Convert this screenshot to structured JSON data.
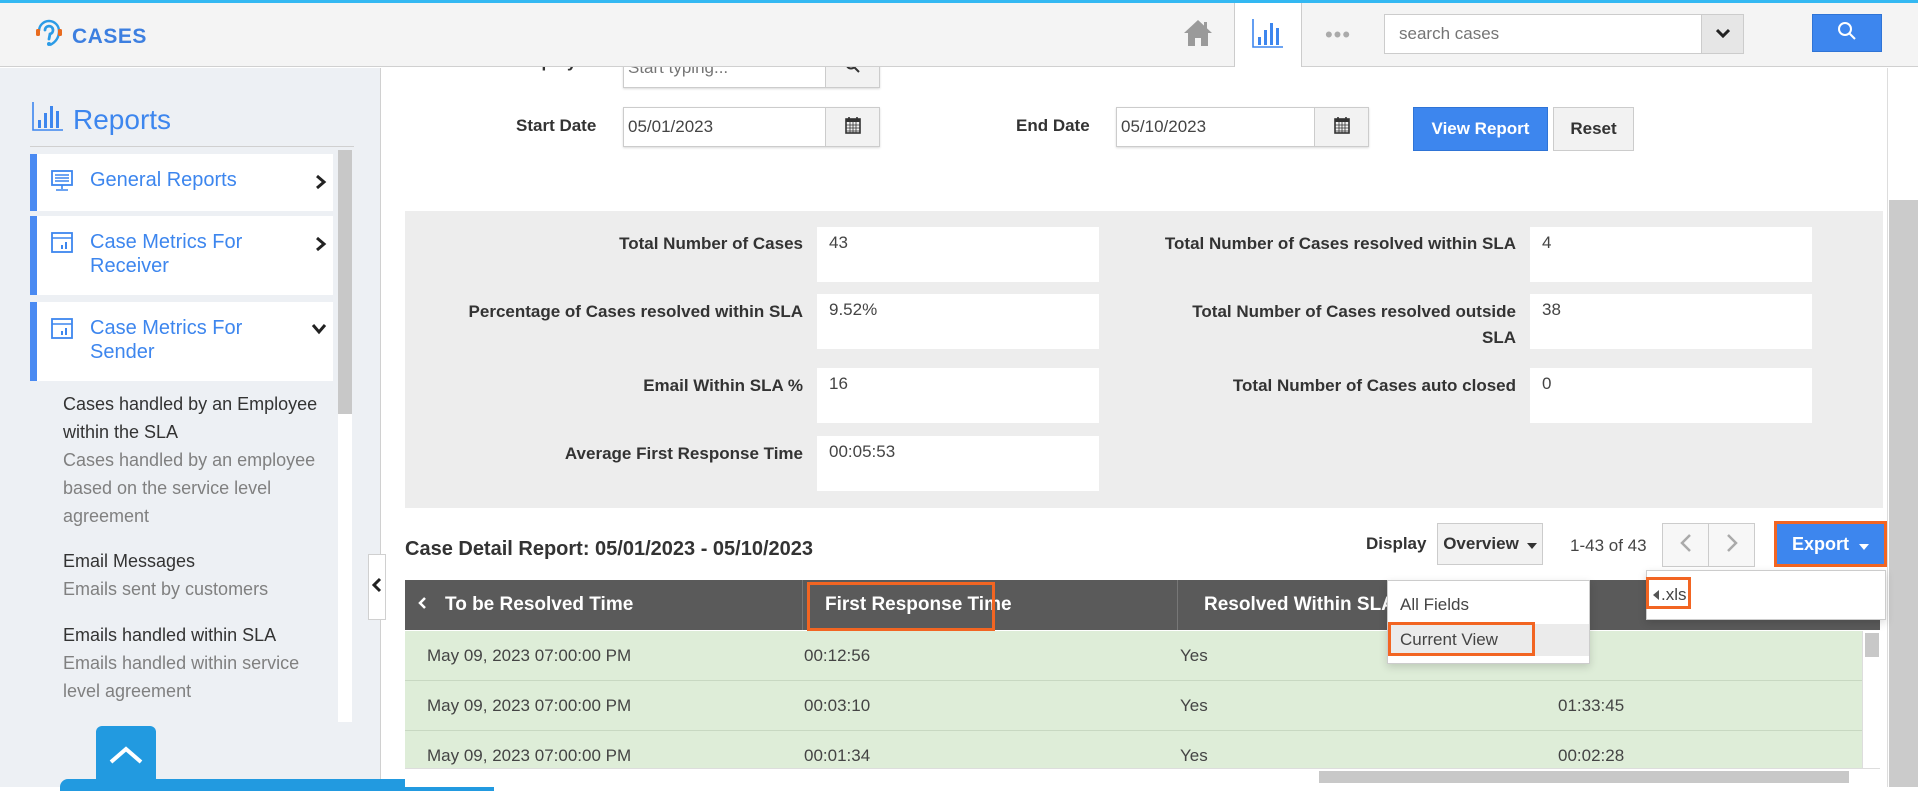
{
  "app": {
    "title": "CASES",
    "logo_icon": "headset-question-icon"
  },
  "header": {
    "nav": [
      {
        "name": "home",
        "icon": "home-icon"
      },
      {
        "name": "reports",
        "icon": "bar-chart-icon",
        "active": true
      },
      {
        "name": "more",
        "icon": "more-dots-icon",
        "label": "•••"
      }
    ],
    "search": {
      "placeholder": "search cases",
      "value": ""
    },
    "accent_color": "#3d86ee",
    "top_line_color": "#33b8f2"
  },
  "sidebar": {
    "title": "Reports",
    "items": [
      {
        "label": "General Reports",
        "icon": "monitor-icon",
        "expanded": false
      },
      {
        "label": "Case Metrics For Receiver",
        "icon": "report-window-icon",
        "expanded": false
      },
      {
        "label": "Case Metrics For Sender",
        "icon": "report-window-icon",
        "expanded": true
      }
    ],
    "sub_items": [
      {
        "title": "Cases handled by an Employee within the SLA",
        "description": "Cases handled by an employee based on the service level agreement"
      },
      {
        "title": "Email Messages",
        "description": "Emails sent by customers"
      },
      {
        "title": "Emails handled within SLA",
        "description": "Emails handled within service level agreement"
      }
    ]
  },
  "filters": {
    "employee_label": "Employee",
    "employee_placeholder": "Start typing...",
    "start_date_label": "Start Date",
    "start_date": "05/01/2023",
    "end_date_label": "End Date",
    "end_date": "05/10/2023",
    "view_report_label": "View Report",
    "reset_label": "Reset"
  },
  "summary": {
    "left": [
      {
        "label": "Total Number of Cases",
        "value": "43"
      },
      {
        "label": "Percentage of Cases resolved within SLA",
        "value": "9.52%"
      },
      {
        "label": "Email Within SLA %",
        "value": "16"
      },
      {
        "label": "Average First Response Time",
        "value": "00:05:53"
      }
    ],
    "right": [
      {
        "label": "Total Number of Cases resolved within SLA",
        "value": "4"
      },
      {
        "label": "Total Number of Cases resolved outside SLA",
        "value": "38"
      },
      {
        "label": "Total Number of Cases auto closed",
        "value": "0"
      }
    ]
  },
  "report": {
    "title": "Case Detail Report: 05/01/2023 - 05/10/2023",
    "display_label": "Display",
    "display_value": "Overview",
    "pager_text": "1-43 of 43",
    "export_label": "Export",
    "export_menu": {
      "format_label": ".xls",
      "options": [
        "All Fields",
        "Current View"
      ],
      "highlighted": "Current View"
    },
    "columns": [
      "To be Resolved Time",
      "First Response Time",
      "Resolved Within SLA",
      ""
    ],
    "rows": [
      [
        "May 09, 2023 07:00:00 PM",
        "00:12:56",
        "Yes",
        ""
      ],
      [
        "May 09, 2023 07:00:00 PM",
        "00:03:10",
        "Yes",
        "01:33:45"
      ],
      [
        "May 09, 2023 07:00:00 PM",
        "00:01:34",
        "Yes",
        "00:02:28"
      ]
    ],
    "highlight_color": "#f26522",
    "row_color": "#deedd8"
  }
}
